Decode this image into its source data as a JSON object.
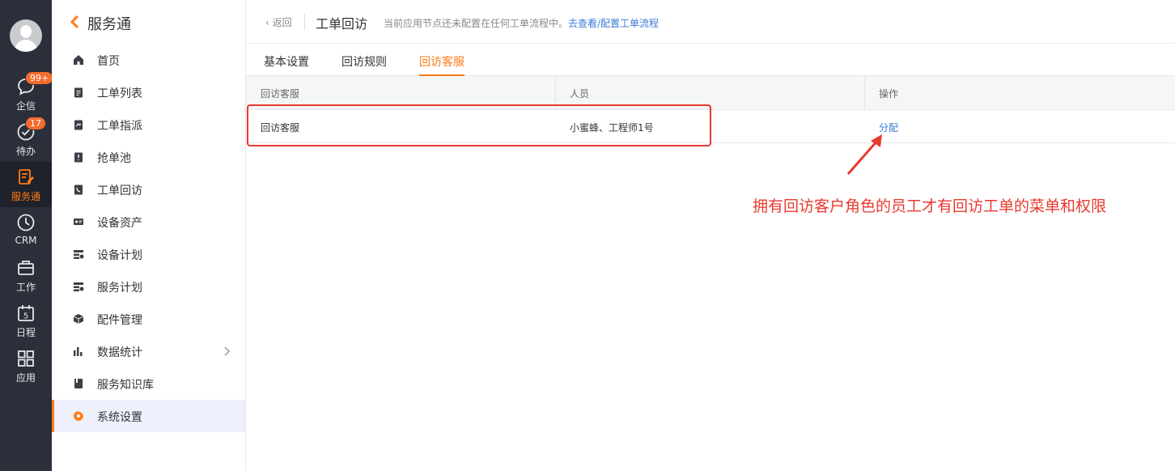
{
  "rail": {
    "items": [
      {
        "label": "企信",
        "badge": "99+"
      },
      {
        "label": "待办",
        "badge": "17"
      },
      {
        "label": "服务通"
      },
      {
        "label": "CRM"
      },
      {
        "label": "工作"
      },
      {
        "label": "日程",
        "icon_digit": "5"
      },
      {
        "label": "应用"
      }
    ],
    "active_index": 2,
    "accent_color": "#ff7a18"
  },
  "sidebar": {
    "title": "服务通",
    "items": [
      {
        "label": "首页",
        "icon": "home-icon"
      },
      {
        "label": "工单列表",
        "icon": "clipboard-icon"
      },
      {
        "label": "工单指派",
        "icon": "assign-icon"
      },
      {
        "label": "抢单池",
        "icon": "grab-icon"
      },
      {
        "label": "工单回访",
        "icon": "phone-icon"
      },
      {
        "label": "设备资产",
        "icon": "device-icon"
      },
      {
        "label": "设备计划",
        "icon": "plan-icon"
      },
      {
        "label": "服务计划",
        "icon": "plan-icon"
      },
      {
        "label": "配件管理",
        "icon": "box-icon"
      },
      {
        "label": "数据统计",
        "icon": "bar-chart-icon"
      },
      {
        "label": "服务知识库",
        "icon": "book-icon"
      },
      {
        "label": "系统设置",
        "icon": "gear-icon"
      }
    ],
    "active_index": 11
  },
  "header": {
    "back_label": "返回",
    "title": "工单回访",
    "notice": "当前应用节点还未配置在任何工单流程中。",
    "notice_link": "去查看/配置工单流程"
  },
  "tabs": [
    {
      "label": "基本设置"
    },
    {
      "label": "回访规则"
    },
    {
      "label": "回访客服"
    }
  ],
  "active_tab": 2,
  "table": {
    "columns": [
      "回访客服",
      "人员",
      "操作"
    ],
    "rows": [
      {
        "name": "回访客服",
        "members": "小蜜蜂、工程师1号",
        "action": "分配"
      }
    ]
  },
  "annotation": {
    "text": "拥有回访客户角色的员工才有回访工单的菜单和权限",
    "color": "#e83a2f"
  }
}
